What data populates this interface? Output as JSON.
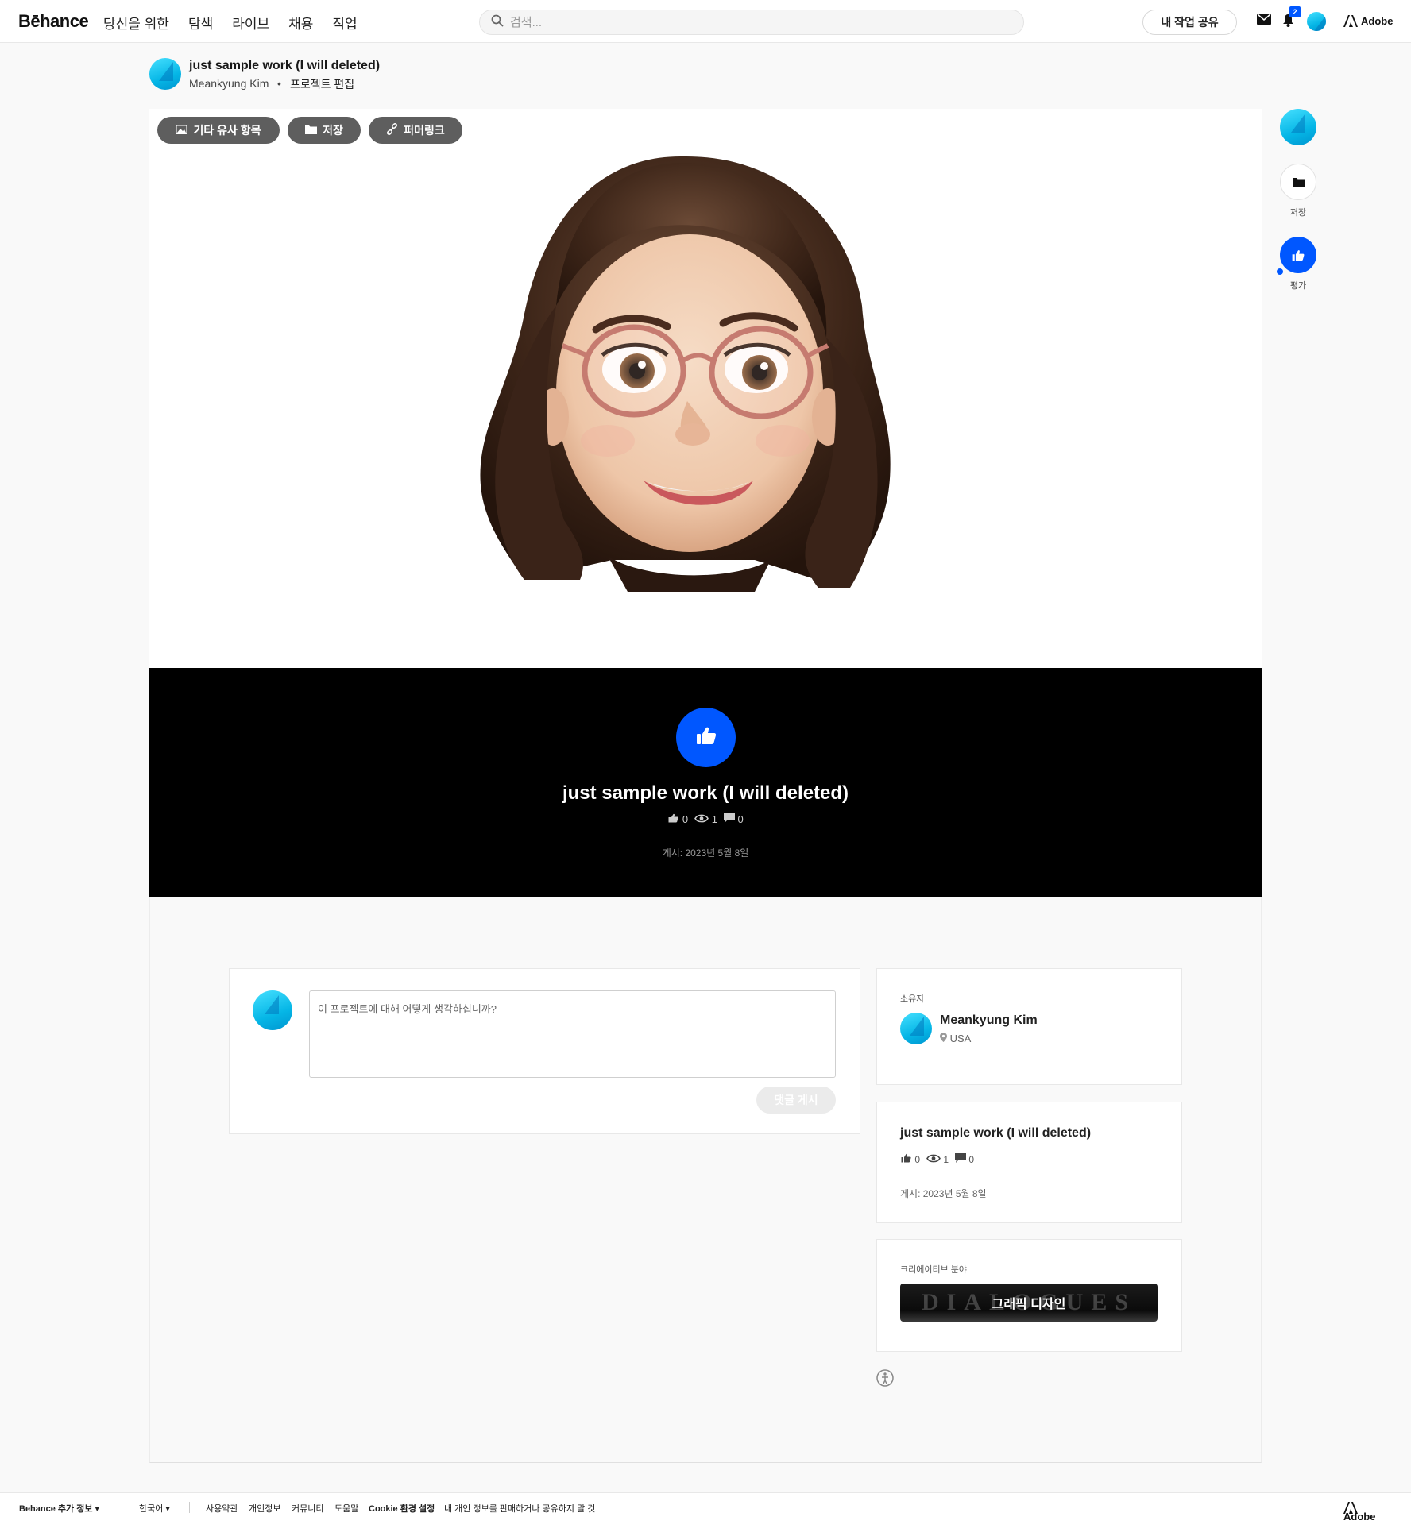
{
  "header": {
    "logo": "Bēhance",
    "nav": [
      "당신을 위한",
      "탐색",
      "라이브",
      "채용",
      "직업"
    ],
    "search_placeholder": "검색...",
    "share_label": "내 작업 공유",
    "notification_count": "2",
    "adobe_label": "Adobe"
  },
  "project": {
    "title": "just sample work (I will deleted)",
    "owner": "Meankyung Kim",
    "separator": "•",
    "edit_label": "프로젝트 편집"
  },
  "canvas_actions": {
    "similar": "기타 유사 항목",
    "save": "저장",
    "permalink": "퍼머링크"
  },
  "band": {
    "title": "just sample work (I will deleted)",
    "likes": "0",
    "views": "1",
    "comments": "0",
    "published": "게시: 2023년 5월 8일"
  },
  "comment": {
    "placeholder": "이 프로젝트에 대해 어떻게 생각하십니까?",
    "post_label": "댓글 게시"
  },
  "owner_card": {
    "label": "소유자",
    "name": "Meankyung Kim",
    "location": "USA"
  },
  "info_card": {
    "title": "just sample work (I will deleted)",
    "likes": "0",
    "views": "1",
    "comments": "0",
    "published": "게시: 2023년 5월 8일"
  },
  "field_card": {
    "label": "크리에이티브 분야",
    "field": "그래픽 디자인"
  },
  "sidebar": {
    "save_label": "저장",
    "appreciate_label": "평가"
  },
  "footer": {
    "more_info": "Behance 추가 정보",
    "language": "한국어",
    "links": [
      "사용약관",
      "개인정보",
      "커뮤니티",
      "도움말",
      "Cookie 환경 설정",
      "내 개인 정보를 판매하거나 공유하지 말 것"
    ],
    "adobe_label": "Adobe"
  },
  "colors": {
    "accent_blue": "#0057ff",
    "avatar_cyan": "#05b6e6",
    "band_black": "#000000"
  }
}
